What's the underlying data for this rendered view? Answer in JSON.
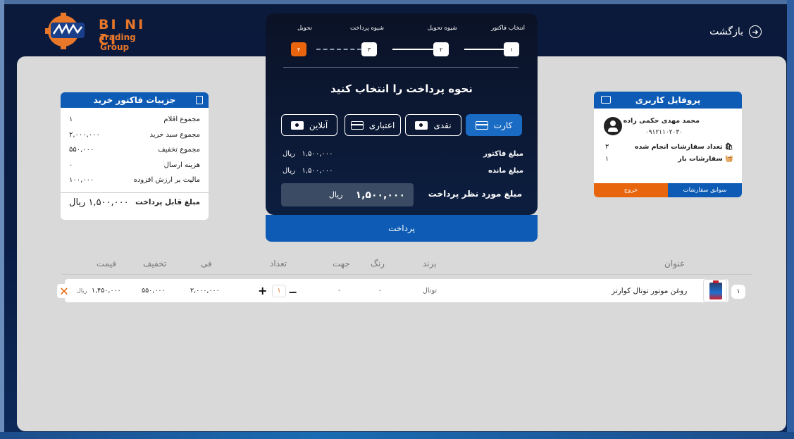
{
  "header": {
    "brand_line1": "BI NI CI",
    "brand_line2": "Trading Group",
    "back_label": "بازگشت"
  },
  "profile": {
    "title": "پروفایل کاربری",
    "name": "محمد مهدی حکمی زاده",
    "phone": "۰۹۱۲۱۱۰۲۰۳۰",
    "stats": [
      {
        "label": "تعداد سفارشات انجام شده",
        "value": "۳"
      },
      {
        "label": "سفارشات باز",
        "value": "۱"
      }
    ],
    "history_label": "سوابق سفارشات",
    "logout_label": "خروج"
  },
  "invoice": {
    "title": "جزییات فاکتور خرید",
    "rows": [
      {
        "label": "مجموع اقلام",
        "value": "۱"
      },
      {
        "label": "مجموع سبد خرید",
        "value": "۲,۰۰۰,۰۰۰"
      },
      {
        "label": "مجموع تخفیف",
        "value": "۵۵۰,۰۰۰"
      },
      {
        "label": "هزینه ارسال",
        "value": "۰"
      },
      {
        "label": "مالیت بر ارزش افزوده",
        "value": "۱۰۰,۰۰۰"
      }
    ],
    "total_label": "مبلغ قابل پرداخت",
    "total_value": "۱,۵۰۰,۰۰۰",
    "total_currency": "ریال"
  },
  "payment": {
    "steps": [
      "انتخاب فاکتور",
      "شیوه تحویل",
      "شیوه پرداخت",
      "تحویل"
    ],
    "step_numbers": [
      "۱",
      "۲",
      "۳",
      "۴"
    ],
    "title": "نحوه پرداخت را انتخاب کنید",
    "methods": [
      "کارت",
      "نقدی",
      "اعتباری",
      "آنلاین"
    ],
    "active_method": "کارت",
    "invoice_amount_label": "مبلغ فاکتور",
    "invoice_amount_value": "۱,۵۰۰,۰۰۰",
    "remaining_label": "مبلغ مانده",
    "remaining_value": "۱,۵۰۰,۰۰۰",
    "currency": "ریال",
    "target_label": "مبلغ مورد نظر پرداخت",
    "target_value": "۱,۵۰۰,۰۰۰",
    "pay_button": "پرداخت"
  },
  "table": {
    "headers": [
      "عنوان",
      "برند",
      "رنگ",
      "جهت",
      "تعداد",
      "فی",
      "تخفیف",
      "قیمت"
    ],
    "rows": [
      {
        "index": "۱",
        "title": "روغن موتور توتال کوارتز",
        "brand": "توتال",
        "color": "-",
        "direction": "-",
        "qty": "۱",
        "unit_price": "۲,۰۰۰,۰۰۰",
        "discount": "۵۵۰,۰۰۰",
        "price": "۱,۴۵۰,۰۰۰",
        "currency": "ریال"
      }
    ]
  },
  "colors": {
    "primary": "#0d5bb5",
    "accent": "#e8650e",
    "panel": "#d9d9d9",
    "dark": "#0b1226"
  }
}
